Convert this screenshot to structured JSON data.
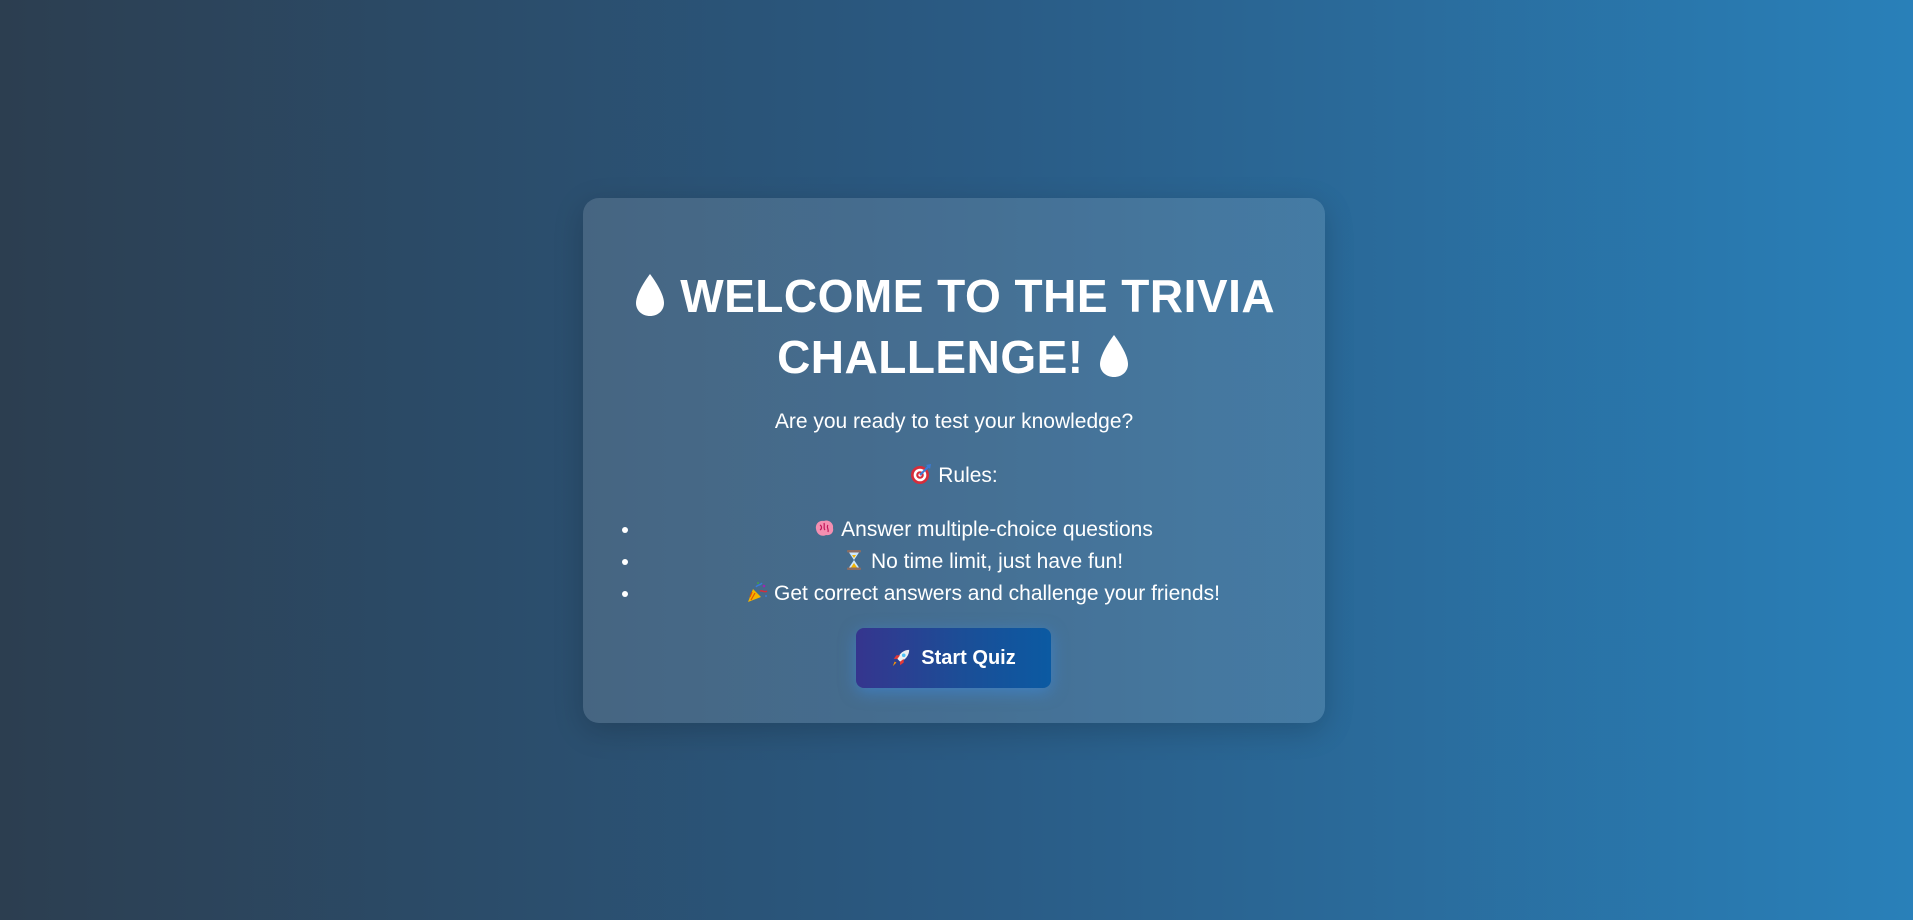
{
  "welcome": {
    "title_line1": "WELCOME TO THE TRIVIA",
    "title_line2": "CHALLENGE!",
    "title_icon": "drop-icon",
    "subtitle": "Are you ready to test your knowledge?",
    "rules_icon": "target-icon",
    "rules_heading": "Rules:",
    "rules": [
      {
        "icon": "brain-icon",
        "text": "Answer multiple-choice questions"
      },
      {
        "icon": "hourglass-icon",
        "text": "No time limit, just have fun!"
      },
      {
        "icon": "party-popper-icon",
        "text": "Get correct answers and challenge your friends!"
      }
    ],
    "start_icon": "rocket-icon",
    "start_button": "Start Quiz"
  },
  "colors": {
    "background_start": "#2c3e50",
    "background_end": "#2980b9",
    "button_start": "#35358e",
    "button_end": "#0b5aa2"
  }
}
